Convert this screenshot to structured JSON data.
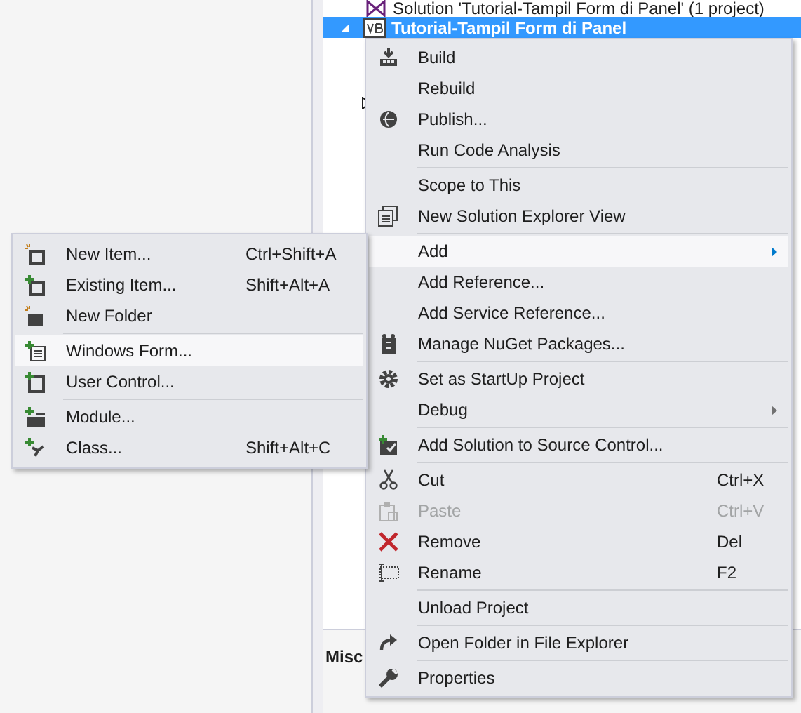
{
  "tree": [
    {
      "label": "Solution 'Tutorial-Tampil Form di Panel' (1 project)",
      "selected": false,
      "bold": false
    },
    {
      "label": "Tutorial-Tampil Form di Panel",
      "selected": true,
      "bold": true
    }
  ],
  "properties_heading": "Misc",
  "context_menu": [
    {
      "kind": "item",
      "label": "Build",
      "selected": false,
      "disabled": false,
      "submenu": false
    },
    {
      "kind": "item",
      "label": "Rebuild",
      "selected": false,
      "disabled": false,
      "submenu": false
    },
    {
      "kind": "item",
      "label": "Publish...",
      "selected": false,
      "disabled": false,
      "submenu": false
    },
    {
      "kind": "item",
      "label": "Run Code Analysis",
      "selected": false,
      "disabled": false,
      "submenu": false
    },
    {
      "kind": "separator"
    },
    {
      "kind": "item",
      "label": "Scope to This",
      "selected": false,
      "disabled": false,
      "submenu": false
    },
    {
      "kind": "item",
      "label": "New Solution Explorer View",
      "selected": false,
      "disabled": false,
      "submenu": false
    },
    {
      "kind": "separator"
    },
    {
      "kind": "item",
      "label": "Add",
      "selected": true,
      "disabled": false,
      "submenu": true
    },
    {
      "kind": "item",
      "label": "Add Reference...",
      "selected": false,
      "disabled": false,
      "submenu": false
    },
    {
      "kind": "item",
      "label": "Add Service Reference...",
      "selected": false,
      "disabled": false,
      "submenu": false
    },
    {
      "kind": "item",
      "label": "Manage NuGet Packages...",
      "selected": false,
      "disabled": false,
      "submenu": false
    },
    {
      "kind": "separator"
    },
    {
      "kind": "item",
      "label": "Set as StartUp Project",
      "selected": false,
      "disabled": false,
      "submenu": false
    },
    {
      "kind": "item",
      "label": "Debug",
      "selected": false,
      "disabled": false,
      "submenu": true
    },
    {
      "kind": "separator"
    },
    {
      "kind": "item",
      "label": "Add Solution to Source Control...",
      "selected": false,
      "disabled": false,
      "submenu": false
    },
    {
      "kind": "separator"
    },
    {
      "kind": "item",
      "label": "Cut",
      "shortcut": "Ctrl+X",
      "selected": false,
      "disabled": false,
      "submenu": false
    },
    {
      "kind": "item",
      "label": "Paste",
      "shortcut": "Ctrl+V",
      "selected": false,
      "disabled": true,
      "submenu": false
    },
    {
      "kind": "item",
      "label": "Remove",
      "shortcut": "Del",
      "selected": false,
      "disabled": false,
      "submenu": false
    },
    {
      "kind": "item",
      "label": "Rename",
      "shortcut": "F2",
      "selected": false,
      "disabled": false,
      "submenu": false
    },
    {
      "kind": "separator"
    },
    {
      "kind": "item",
      "label": "Unload Project",
      "selected": false,
      "disabled": false,
      "submenu": false
    },
    {
      "kind": "separator"
    },
    {
      "kind": "item",
      "label": "Open Folder in File Explorer",
      "selected": false,
      "disabled": false,
      "submenu": false
    },
    {
      "kind": "separator"
    },
    {
      "kind": "item",
      "label": "Properties",
      "selected": false,
      "disabled": false,
      "submenu": false
    }
  ],
  "add_submenu": [
    {
      "kind": "item",
      "label": "New Item...",
      "shortcut": "Ctrl+Shift+A",
      "selected": false
    },
    {
      "kind": "item",
      "label": "Existing Item...",
      "shortcut": "Shift+Alt+A",
      "selected": false
    },
    {
      "kind": "item",
      "label": "New Folder",
      "selected": false
    },
    {
      "kind": "separator"
    },
    {
      "kind": "item",
      "label": "Windows Form...",
      "selected": true
    },
    {
      "kind": "item",
      "label": "User Control...",
      "selected": false
    },
    {
      "kind": "separator"
    },
    {
      "kind": "item",
      "label": "Module...",
      "selected": false
    },
    {
      "kind": "item",
      "label": "Class...",
      "shortcut": "Shift+Alt+C",
      "selected": false
    }
  ]
}
